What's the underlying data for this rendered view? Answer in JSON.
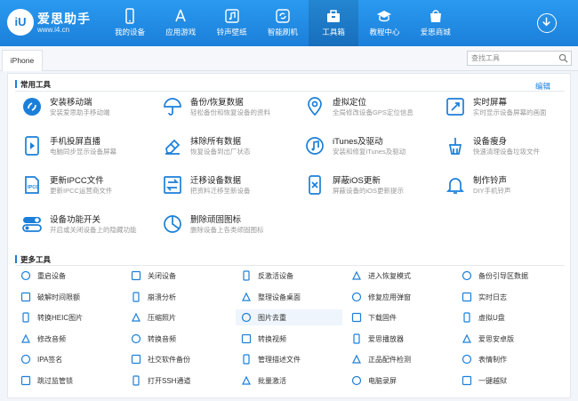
{
  "app": {
    "logo_badge": "iU",
    "logo_title": "爱思助手",
    "logo_url": "www.i4.cn",
    "accent_color": "#1b7fd9"
  },
  "nav": {
    "items": [
      {
        "label": "我的设备",
        "icon": "phone-icon"
      },
      {
        "label": "应用游戏",
        "icon": "app-store-icon"
      },
      {
        "label": "铃声壁纸",
        "icon": "music-icon"
      },
      {
        "label": "智能刷机",
        "icon": "refresh-box-icon"
      },
      {
        "label": "工具箱",
        "icon": "toolbox-icon",
        "active": true
      },
      {
        "label": "教程中心",
        "icon": "graduation-cap-icon"
      },
      {
        "label": "爱思商城",
        "icon": "store-icon"
      }
    ]
  },
  "tabs": {
    "device": "iPhone",
    "search_placeholder": "查找工具"
  },
  "common": {
    "heading": "常用工具",
    "edit_label": "编辑",
    "tools": [
      {
        "title": "安装移动端",
        "desc": "安装爱思助手移动端",
        "icon": "install-mobile-icon"
      },
      {
        "title": "备份/恢复数据",
        "desc": "轻松备份和恢复设备的资料",
        "icon": "umbrella-icon"
      },
      {
        "title": "虚拟定位",
        "desc": "全局修改设备GPS定位信息",
        "icon": "location-pin-icon"
      },
      {
        "title": "实时屏幕",
        "desc": "实时显示设备屏幕的画面",
        "icon": "screen-mirror-icon"
      },
      {
        "title": "手机投屏直播",
        "desc": "电脑同步显示设备屏幕",
        "icon": "phone-play-icon"
      },
      {
        "title": "抹除所有数据",
        "desc": "恢复设备到出厂状态",
        "icon": "eraser-icon"
      },
      {
        "title": "iTunes及驱动",
        "desc": "安装和修复iTunes及驱动",
        "icon": "itunes-icon"
      },
      {
        "title": "设备瘦身",
        "desc": "快速清理设备垃圾文件",
        "icon": "broom-icon"
      },
      {
        "title": "更新IPCC文件",
        "desc": "更新IPCC运营商文件",
        "icon": "ipcc-file-icon"
      },
      {
        "title": "迁移设备数据",
        "desc": "把资料迁移至新设备",
        "icon": "migrate-icon"
      },
      {
        "title": "屏蔽iOS更新",
        "desc": "屏蔽设备的iOS更新提示",
        "icon": "block-update-icon"
      },
      {
        "title": "制作铃声",
        "desc": "DIY手机铃声",
        "icon": "bell-icon"
      },
      {
        "title": "设备功能开关",
        "desc": "开启或关闭设备上的隐藏功能",
        "icon": "toggle-icon"
      },
      {
        "title": "删除顽固图标",
        "desc": "删除设备上各类顽固图标",
        "icon": "pie-chart-icon"
      }
    ]
  },
  "more": {
    "heading": "更多工具",
    "tools": [
      {
        "label": "重启设备",
        "icon": "restart-icon"
      },
      {
        "label": "关闭设备",
        "icon": "power-icon"
      },
      {
        "label": "反激活设备",
        "icon": "deactivate-icon"
      },
      {
        "label": "进入恢复模式",
        "icon": "recovery-mode-icon"
      },
      {
        "label": "备份引导区数据",
        "icon": "backup-boot-icon"
      },
      {
        "label": "破解时间限额",
        "icon": "hourglass-icon"
      },
      {
        "label": "崩溃分析",
        "icon": "crash-analysis-icon"
      },
      {
        "label": "整理设备桌面",
        "icon": "organize-desktop-icon"
      },
      {
        "label": "修复应用弹窗",
        "icon": "repair-popup-icon"
      },
      {
        "label": "实时日志",
        "icon": "log-icon"
      },
      {
        "label": "转换HEIC图片",
        "icon": "heic-icon"
      },
      {
        "label": "压缩照片",
        "icon": "compress-photo-icon"
      },
      {
        "label": "图片去重",
        "icon": "dedupe-image-icon",
        "highlight": true
      },
      {
        "label": "下载固件",
        "icon": "download-firmware-icon"
      },
      {
        "label": "虚拟U盘",
        "icon": "usb-drive-icon"
      },
      {
        "label": "修改音频",
        "icon": "edit-audio-icon"
      },
      {
        "label": "转换音频",
        "icon": "convert-audio-icon"
      },
      {
        "label": "转换视频",
        "icon": "convert-video-icon"
      },
      {
        "label": "爱思播放器",
        "icon": "player-icon"
      },
      {
        "label": "爱思安卓版",
        "icon": "android-icon"
      },
      {
        "label": "IPA签名",
        "icon": "ipa-sign-icon"
      },
      {
        "label": "社交软件备份",
        "icon": "social-backup-icon"
      },
      {
        "label": "管理描述文件",
        "icon": "profile-icon"
      },
      {
        "label": "正品配件检测",
        "icon": "accessory-check-icon"
      },
      {
        "label": "表情制作",
        "icon": "emoji-icon"
      },
      {
        "label": "跳过监管锁",
        "icon": "skip-lock-icon"
      },
      {
        "label": "打开SSH通道",
        "icon": "ssh-icon"
      },
      {
        "label": "批量激活",
        "icon": "batch-activate-icon"
      },
      {
        "label": "电脑录屏",
        "icon": "screen-record-icon"
      },
      {
        "label": "一键越狱",
        "icon": "jailbreak-icon"
      }
    ]
  }
}
